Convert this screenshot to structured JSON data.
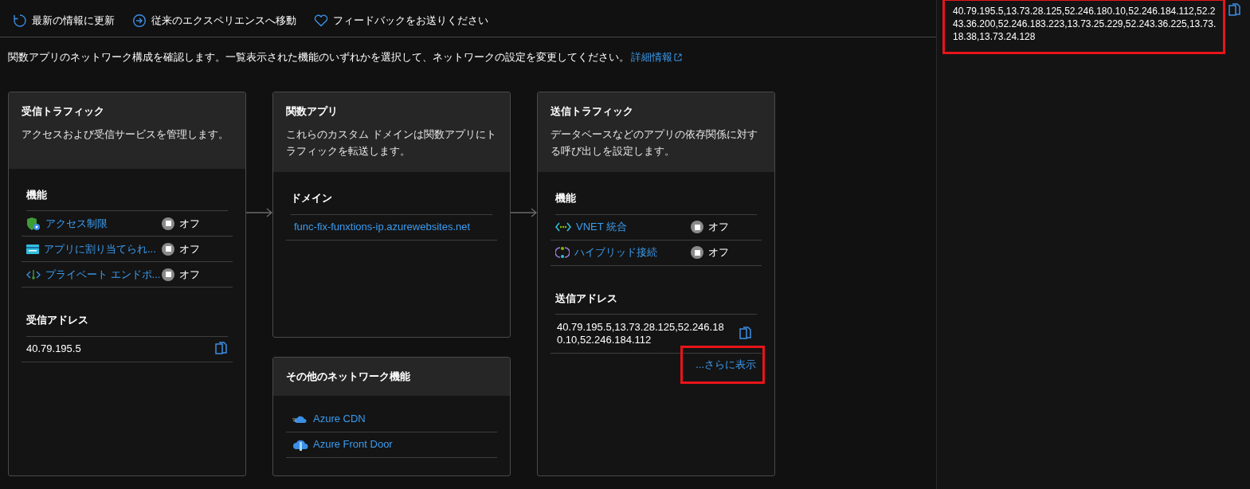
{
  "toolbar": [
    {
      "label": "最新の情報に更新"
    },
    {
      "label": "従来のエクスペリエンスへ移動"
    },
    {
      "label": "フィードバックをお送りください"
    }
  ],
  "description": {
    "text": "関数アプリのネットワーク構成を確認します。一覧表示された機能のいずれかを選択して、ネットワークの設定を変更してください。",
    "link": "詳細情報"
  },
  "inbound": {
    "title": "受信トラフィック",
    "description": "アクセスおよび受信サービスを管理します。",
    "features_heading": "機能",
    "features": [
      {
        "label": "アクセス制限",
        "status": "オフ",
        "on": false
      },
      {
        "label": "アプリに割り当てられ...",
        "status": "オフ",
        "on": false
      },
      {
        "label": "プライベート エンドポ...",
        "status": "オフ",
        "on": false
      }
    ],
    "address_heading": "受信アドレス",
    "address": "40.79.195.5"
  },
  "function_app": {
    "title": "関数アプリ",
    "description": "これらのカスタム ドメインは関数アプリにトラフィックを転送します。",
    "domain_heading": "ドメイン",
    "domains": [
      "func-fix-funxtions-ip.azurewebsites.net"
    ]
  },
  "other_features": {
    "title": "その他のネットワーク機能",
    "items": [
      "Azure CDN",
      "Azure Front Door"
    ]
  },
  "outbound": {
    "title": "送信トラフィック",
    "description": "データベースなどのアプリの依存関係に対する呼び出しを設定します。",
    "features_heading": "機能",
    "features": [
      {
        "label": "VNET 統合",
        "status": "オフ",
        "on": false
      },
      {
        "label": "ハイブリッド接続",
        "status": "オフ",
        "on": false
      }
    ],
    "address_heading": "送信アドレス",
    "address": "40.79.195.5,13.73.28.125,52.246.180.10,52.246.184.112",
    "show_more": "...さらに表示"
  },
  "side_panel": {
    "addresses": "40.79.195.5,13.73.28.125,52.246.180.10,52.246.184.112,52.243.36.200,52.246.183.223,13.73.25.229,52.243.36.225,13.73.18.38,13.73.24.128"
  }
}
